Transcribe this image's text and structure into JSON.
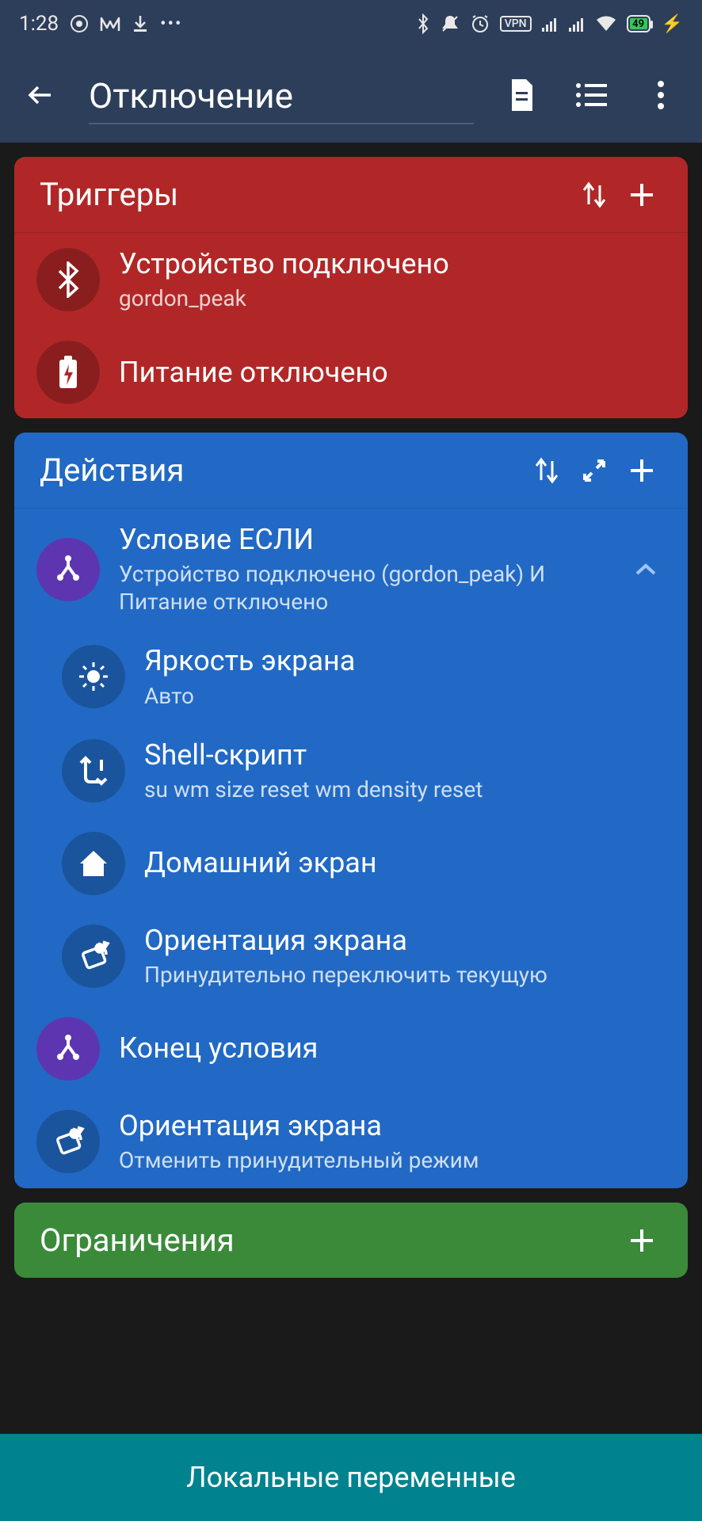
{
  "status": {
    "time": "1:28",
    "battery": "49",
    "vpn": "VPN"
  },
  "appbar": {
    "title": "Отключение"
  },
  "triggers": {
    "title": "Триггеры",
    "items": [
      {
        "title": "Устройство подключено",
        "sub": "gordon_peak"
      },
      {
        "title": "Питание отключено",
        "sub": ""
      }
    ]
  },
  "actions": {
    "title": "Действия",
    "items": [
      {
        "title": "Условие ЕСЛИ",
        "sub": "Устройство подключено (gordon_peak) И Питание отключено"
      },
      {
        "title": "Яркость экрана",
        "sub": "Авто"
      },
      {
        "title": "Shell-скрипт",
        "sub": "su wm size reset wm density reset"
      },
      {
        "title": "Домашний экран",
        "sub": ""
      },
      {
        "title": "Ориентация экрана",
        "sub": "Принудительно переключить текущую"
      },
      {
        "title": "Конец условия",
        "sub": ""
      },
      {
        "title": "Ориентация экрана",
        "sub": "Отменить принудительный режим"
      }
    ]
  },
  "constraints": {
    "title": "Ограничения"
  },
  "bottom": {
    "label": "Локальные переменные"
  }
}
